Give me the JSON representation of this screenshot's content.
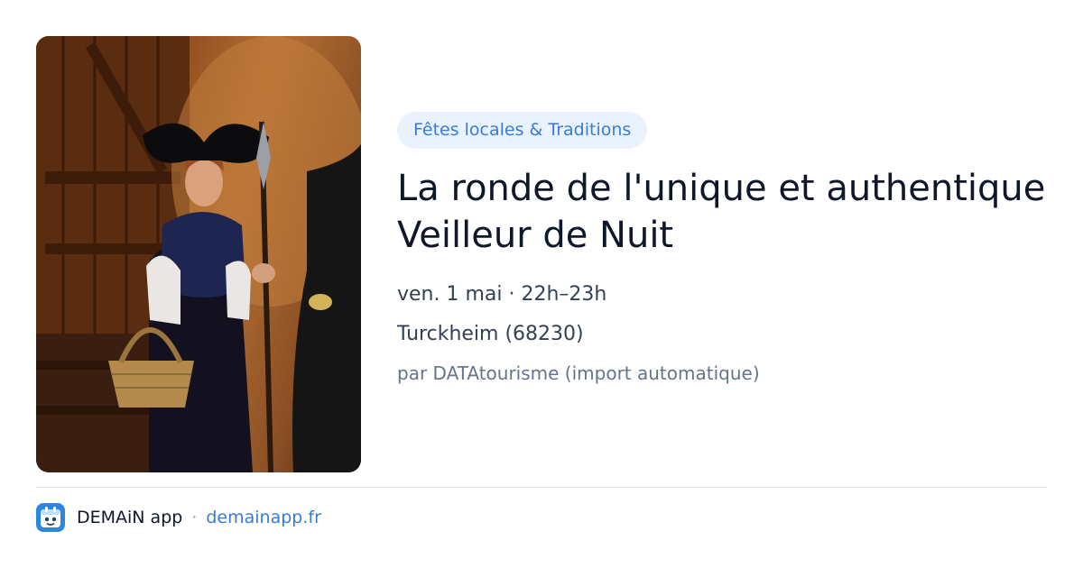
{
  "event": {
    "category": "Fêtes locales & Traditions",
    "title": "La ronde de l'unique et authentique Veilleur de Nuit",
    "datetime": "ven. 1 mai · 22h–23h",
    "location": "Turckheim (68230)",
    "source": "par DATAtourisme (import automatique)",
    "image": "night-watchman-photo"
  },
  "footer": {
    "logo_icon": "demain-app-logo-icon",
    "app_name": "DEMAiN app",
    "separator": "·",
    "site": "demainapp.fr"
  },
  "colors": {
    "accent": "#3a7bd5",
    "badge_bg": "#eaf2fd",
    "title": "#0f172a",
    "muted": "#64748b",
    "logo_bg": "#2f86e0"
  }
}
